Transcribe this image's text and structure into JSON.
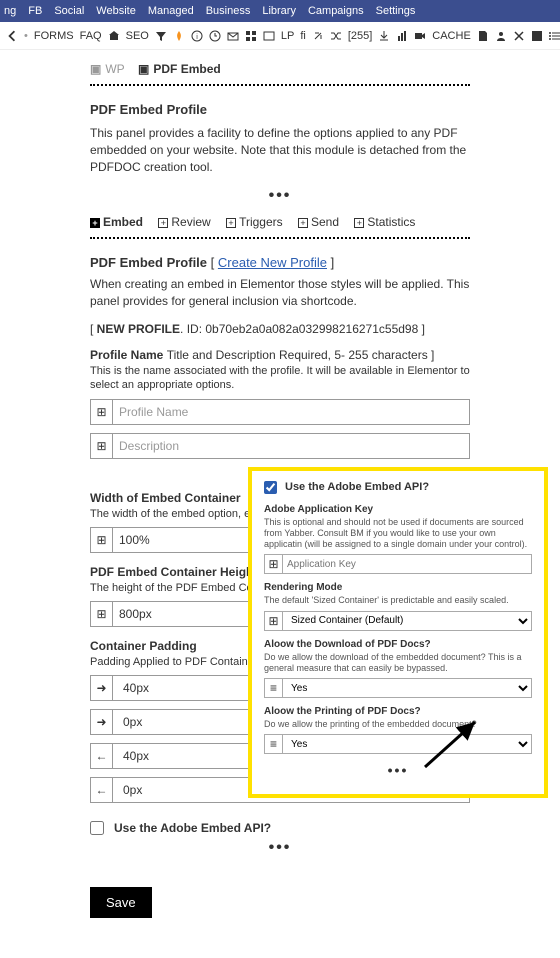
{
  "nav": {
    "items": [
      "ng",
      "FB",
      "Social",
      "Website",
      "Managed",
      "Business",
      "Library",
      "Campaigns",
      "Settings"
    ]
  },
  "toolbar": {
    "forms": "FORMS",
    "faq": "FAQ",
    "seo": "SEO",
    "count": "[255]",
    "lp": "LP",
    "fi": "fi",
    "cache": "CACHE"
  },
  "breadcrumb": {
    "wp": "WP",
    "pdf": "PDF Embed"
  },
  "section": {
    "title": "PDF Embed Profile",
    "desc": "This panel provides a facility to define the options applied to any PDF embedded on your website. Note that this module is detached from the PDFDOC creation tool."
  },
  "tabs": [
    "Embed",
    "Review",
    "Triggers",
    "Send",
    "Statistics"
  ],
  "profile": {
    "heading": "PDF Embed Profile",
    "create_link": "Create New Profile",
    "intro": "When creating an embed in Elementor those styles will be applied. This panel provides for general inclusion via shortcode.",
    "new_label": "NEW PROFILE",
    "id_label": "ID:",
    "id_value": "0b70eb2a0a082a032998216271c55d98"
  },
  "fields": {
    "name": {
      "label": "Profile Name",
      "hint": "Title and Description Required, 5- 255 characters ]",
      "help": "This is the name associated with the profile. It will be available in Elementor to select an appropriate options.",
      "placeholder": "Profile Name"
    },
    "description": {
      "placeholder": "Description"
    },
    "width": {
      "label": "Width of Embed Container",
      "help": "The width of the embed option, e",
      "value": "100%"
    },
    "height": {
      "label": "PDF Embed Container Height",
      "help": "The height of the PDF Embed Con",
      "value": "800px"
    },
    "padding": {
      "label": "Container Padding",
      "help": "Padding Applied to PDF Container",
      "values": [
        "40px",
        "0px",
        "40px",
        "0px"
      ]
    },
    "api": {
      "label": "Use the Adobe Embed API?"
    }
  },
  "overlay": {
    "checkbox_label": "Use the Adobe Embed API?",
    "appkey": {
      "label": "Adobe Application Key",
      "help": "This is optional and should not be used if documents are sourced from Yabber. Consult BM if you would like to use your own applicatin (will be assigned to a single domain under your control).",
      "placeholder": "Application Key"
    },
    "render": {
      "label": "Rendering Mode",
      "help": "The default 'Sized Container' is predictable and easily scaled.",
      "value": "Sized Container (Default)"
    },
    "download": {
      "label": "Aloow the Download of PDF Docs?",
      "help": "Do we allow the download of the embedded document? This is a general measure that can easily be bypassed.",
      "value": "Yes"
    },
    "print": {
      "label": "Aloow the Printing of PDF Docs?",
      "help": "Do we allow the printing of the embedded document?",
      "value": "Yes"
    }
  },
  "save": "Save"
}
